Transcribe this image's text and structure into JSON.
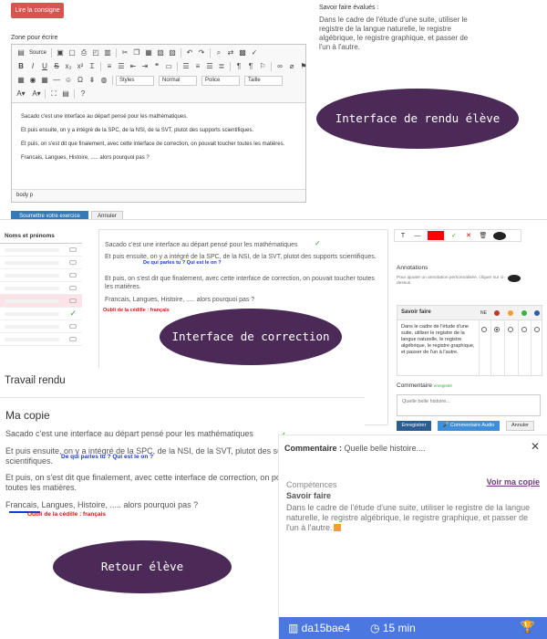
{
  "student_interface": {
    "read_button": "Lire la consigne",
    "zone_label": "Zone pour écrire",
    "toolbar": {
      "source_label": "Source",
      "styles_combo": "Styles",
      "format_combo": "Normal",
      "font_combo": "Police",
      "size_combo": "Taille"
    },
    "content": [
      "Sacado c'est une interface au départ pensé pour les mathématiques.",
      "Et puis ensuite, on y a intégré de la SPC, de la NSI, de la SVT, plutot des supports scientifiques.",
      "Et puis, on s'est dit que finalement, avec cette interface de correction, on pouvait toucher toutes les matières.",
      "Francais, Langues, Histoire, ..... alors pourquoi pas ?"
    ],
    "status_path": "body  p",
    "submit_button": "Soumettre votre exercice",
    "cancel_button": "Annuler",
    "skills_title": "Savoir faire évalués :",
    "skills_text": "Dans le cadre de l'étude d'une suite, utiliser le registre de la langue naturelle, le registre algébrique, le registre graphique, et passer de l'un à l'autre.",
    "caption": "Interface de rendu élève"
  },
  "correction_interface": {
    "students_header": "Noms et prénoms",
    "doc_lines": [
      "Sacado c'est une interface au départ pensé pour les mathématiques",
      "Et puis ensuite, on y a intégré de la SPC, de la NSI, de la SVT, plutot des supports scientifiques.",
      "Et puis, on s'est dit que finalement, avec cette interface de correction, on pouvait toucher toutes les matières.",
      "Francais, Langues, Histoire, ..... alors pourquoi pas ?"
    ],
    "annotation_question": "De qui parles tu ? Qui est le on ?",
    "annotation_cedilla": "Oubli de la cédille : français",
    "annotations_title": "Annotations",
    "annotations_hint": "Pour ajouter un annotation personnalisée, cliquer sur  ci-dessus.",
    "skills_header": "Savoir faire",
    "ne_label": "NE",
    "level_colors": [
      "#c0392b",
      "#f0a030",
      "#3cb043",
      "#2c5ea8"
    ],
    "skill_text": "Dans le cadre de l'étude d'une suite, utiliser le registre de la langue naturelle, le registre algébrique, le registre graphique, et passer de l'un à l'autre.",
    "comment_title": "Commentaire",
    "comment_saved": "enregistré",
    "comment_placeholder": "Quelle belle histoire...",
    "save_button": "Enregistrer",
    "audio_button": "Commentaire Audio",
    "cancel_button": "Annuler",
    "caption": "Interface de correction"
  },
  "student_feedback": {
    "header": "Travail rendu",
    "copy_title": "Ma copie",
    "lines": [
      "Sacado c'est une interface au départ pensé pour les mathématiques",
      "Et puis ensuite, on y a intégré de la SPC, de la NSI, de la SVT, plutot des supports scientifiques.",
      "Et puis, on s'est dit que finalement, avec cette interface de correction, on pouvait toucher toutes les matières.",
      "Francais, Langues, Histoire, ..... alors pourquoi pas ?"
    ],
    "annotation_question": "De qui parles tu ? Qui est le on ?",
    "annotation_cedilla": "Oubli de la cédille : français",
    "caption": "Retour élève",
    "card": {
      "comment_label": "Commentaire :",
      "comment_text": "Quelle belle histoire....",
      "view_link": "Voir ma copie",
      "competences_label": "Compétences",
      "skill_title": "Savoir faire",
      "skill_text": "Dans le cadre de l'étude d'une suite, utiliser le registre de la langue naturelle, le registre algébrique, le registre graphique, et passer de l'un à l'autre.",
      "code": "da15bae4",
      "duration": "15 min"
    }
  }
}
